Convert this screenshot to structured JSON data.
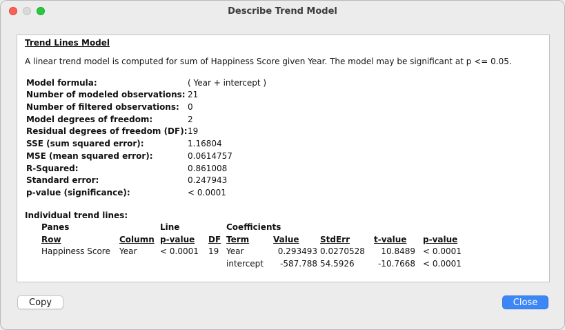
{
  "window": {
    "title": "Describe Trend Model"
  },
  "report": {
    "section_title": "Trend Lines Model",
    "description": "A linear trend model is computed for sum of Happiness Score given Year.  The model may be significant at p <= 0.05.",
    "stats": [
      {
        "label": "Model formula:",
        "value": "( Year + intercept )"
      },
      {
        "label": "Number of modeled observations:",
        "value": "21"
      },
      {
        "label": "Number of filtered observations:",
        "value": "0"
      },
      {
        "label": "Model degrees of freedom:",
        "value": "2"
      },
      {
        "label": "Residual degrees of freedom (DF):",
        "value": "19"
      },
      {
        "label": "SSE (sum squared error):",
        "value": "1.16804"
      },
      {
        "label": "MSE (mean squared error):",
        "value": "0.0614757"
      },
      {
        "label": "R-Squared:",
        "value": "0.861008"
      },
      {
        "label": "Standard error:",
        "value": "0.247943"
      },
      {
        "label": "p-value (significance):",
        "value": "< 0.0001"
      }
    ],
    "individual_title": "Individual trend lines:",
    "group_headers": {
      "panes": "Panes",
      "line": "Line",
      "coefficients": "Coefficients"
    },
    "column_headers": {
      "row": "Row",
      "column": "Column",
      "line_pvalue": "p-value",
      "df": "DF",
      "term": "Term",
      "value": "Value",
      "stderr": "StdErr",
      "tvalue": "t-value",
      "pvalue": "p-value"
    },
    "rows": [
      {
        "row": "Happiness Score",
        "column": "Year",
        "line_pvalue": "< 0.0001",
        "df": "19",
        "term": "Year",
        "value": "0.293493",
        "stderr": "0.0270528",
        "tvalue": "10.8489",
        "pvalue": "< 0.0001"
      },
      {
        "row": "",
        "column": "",
        "line_pvalue": "",
        "df": "",
        "term": "intercept",
        "value": "-587.788",
        "stderr": "54.5926",
        "tvalue": "-10.7668",
        "pvalue": "< 0.0001"
      }
    ]
  },
  "buttons": {
    "copy": "Copy",
    "close": "Close"
  }
}
